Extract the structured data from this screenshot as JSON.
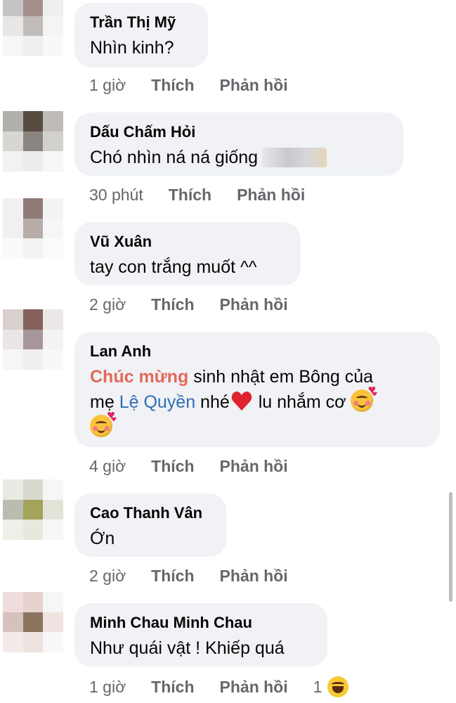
{
  "comments": [
    {
      "author": "Trần Thị Mỹ",
      "text": "Nhìn  kinh?",
      "time": "1 giờ",
      "like": "Thích",
      "reply": "Phản hồi",
      "avatar": [
        "#c5c3c3",
        "#a48f8b",
        "#f1efee",
        "#e8e6e6",
        "#c1bcba",
        "#f4f4f4",
        "#f6f6f6",
        "#eeeeee",
        "#f8f8f8"
      ]
    },
    {
      "author": "Dấu Chấm Hỏi",
      "text": "Chó nhìn ná ná giống",
      "time": "30 phút",
      "like": "Thích",
      "reply": "Phản hồi",
      "avatar": [
        "#aeb0ab",
        "#584b41",
        "#bfbcb8",
        "#d8d6d2",
        "#8b8580",
        "#d3d1cd",
        "#f2f2f2",
        "#ececec",
        "#f6f6f6"
      ]
    },
    {
      "author": "Vũ Xuân",
      "text": "tay con trắng muốt ^^",
      "time": "2 giờ",
      "like": "Thích",
      "reply": "Phản hồi",
      "avatar": [
        "#f1f1f1",
        "#917b76",
        "#f3f3f3",
        "#f0f0f0",
        "#b7aca7",
        "#f6f6f6",
        "#fafafa",
        "#f2f2f2",
        "#fbfbfb"
      ]
    },
    {
      "author": "Lan Anh",
      "text_parts": {
        "highlight": "Chúc mừng",
        "line1_rest": " sinh nhật em Bông của",
        "line2_start": "mẹ ",
        "tag": "Lệ Quyền",
        "line2_end": " nhé",
        "line2_after_heart": " lu nhắm cơ "
      },
      "time": "4 giờ",
      "like": "Thích",
      "reply": "Phản hồi",
      "avatar": [
        "#d8cfcf",
        "#86615c",
        "#ece8e8",
        "#ebe6e6",
        "#a8979a",
        "#f4f2f2",
        "#f6f6f6",
        "#efefef",
        "#f8f8f8"
      ]
    },
    {
      "author": "Cao Thanh Vân",
      "text": "Ớn",
      "time": "2 giờ",
      "like": "Thích",
      "reply": "Phản hồi",
      "avatar": [
        "#e9ebe2",
        "#d8d9cd",
        "#f6f6f6",
        "#b9bcae",
        "#a3a35a",
        "#e2e4d8",
        "#eef0e8",
        "#e6e9db",
        "#f7f7f7"
      ]
    },
    {
      "author": "Minh Chau Minh Chau",
      "text": "Như quái vật ! Khiếp quá",
      "time": "1 giờ",
      "like": "Thích",
      "reply": "Phản hồi",
      "reaction_count": "1",
      "avatar": [
        "#efdcdd",
        "#e7d2cf",
        "#f6f6f6",
        "#d5c2bd",
        "#8a7460",
        "#efe3e1",
        "#f3ebea",
        "#ede3df",
        "#f8f8f8"
      ]
    }
  ],
  "colors": {
    "bubble": "#f0f2f5",
    "action_text": "#65676b",
    "highlight_red": "#e4695a",
    "tag_blue": "#2f6db5"
  }
}
